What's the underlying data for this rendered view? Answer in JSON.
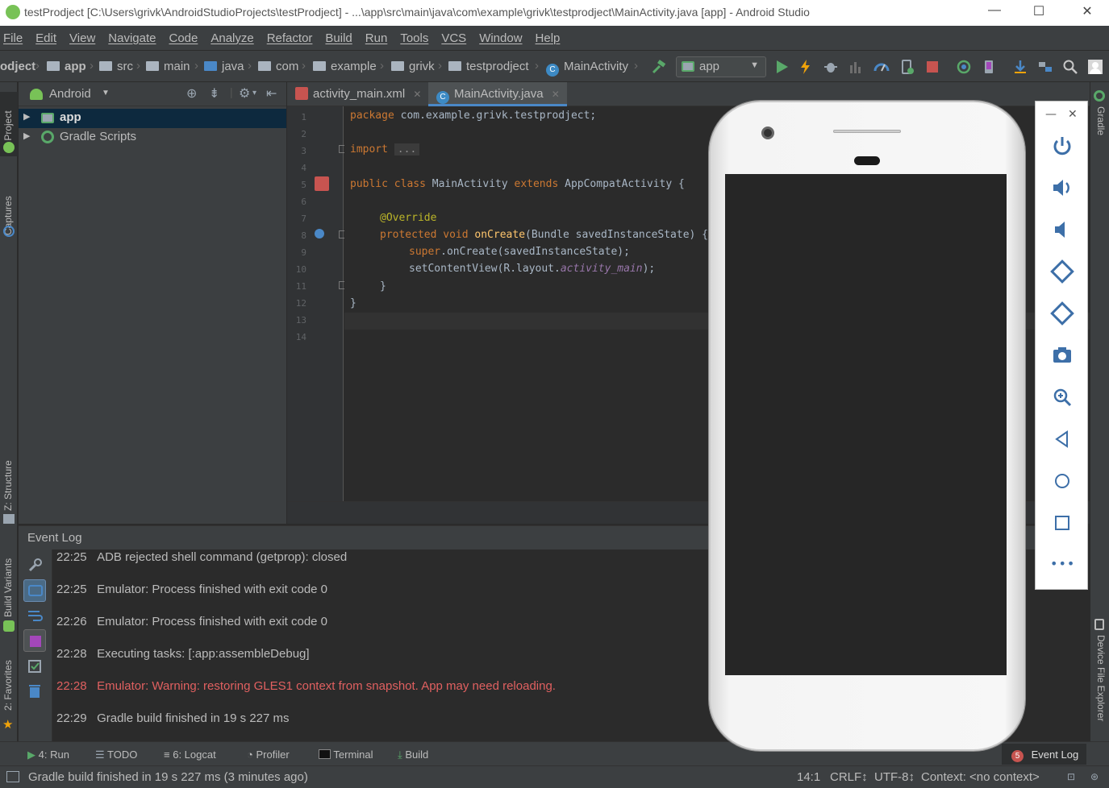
{
  "window": {
    "title": "testProdject [C:\\Users\\grivk\\AndroidStudioProjects\\testProdject] - ...\\app\\src\\main\\java\\com\\example\\grivk\\testprodject\\MainActivity.java [app] - Android Studio",
    "minimize": "—",
    "maximize": "☐",
    "close": "✕"
  },
  "menu": [
    "File",
    "Edit",
    "View",
    "Navigate",
    "Code",
    "Analyze",
    "Refactor",
    "Build",
    "Run",
    "Tools",
    "VCS",
    "Window",
    "Help"
  ],
  "breadcrumbs": [
    "odject",
    "app",
    "src",
    "main",
    "java",
    "com",
    "example",
    "grivk",
    "testprodject",
    "MainActivity"
  ],
  "run_config": "app",
  "left_tabs": {
    "project": "1: Project",
    "captures": "Captures",
    "structure": "Z: Structure",
    "build_variants": "Build Variants",
    "favorites": "2: Favorites"
  },
  "project_panel": {
    "view_mode": "Android",
    "tree": [
      {
        "label": "app",
        "selected": true
      },
      {
        "label": "Gradle Scripts",
        "selected": false
      }
    ]
  },
  "editor": {
    "tabs": [
      {
        "label": "activity_main.xml",
        "active": false
      },
      {
        "label": "MainActivity.java",
        "active": true
      }
    ],
    "line_numbers": [
      "1",
      "2",
      "3",
      "4",
      "5",
      "6",
      "7",
      "8",
      "9",
      "10",
      "11",
      "12",
      "13",
      "14"
    ],
    "code": {
      "l1_kw": "package",
      "l1_rest": " com.example.grivk.testprodject;",
      "l3_kw": "import",
      "l3_fold": "...",
      "l6_kw": "public class",
      "l6_name": " MainActivity ",
      "l6_kw2": "extends",
      "l6_rest": " AppCompatActivity {",
      "l8_ann": "@Override",
      "l9_kw": "protected void",
      "l9_fn": " onCreate",
      "l9_rest": "(Bundle savedInstanceState) {",
      "l10_kw": "super",
      "l10_rest": ".onCreate(savedInstanceState);",
      "l11_a": "setContentView(R.layout.",
      "l11_it": "activity_main",
      "l11_b": ");",
      "l12": "}",
      "l13": "}"
    }
  },
  "event_log": {
    "title": "Event Log",
    "entries": [
      {
        "time": "22:25",
        "text": "ADB rejected shell command (getprop): closed",
        "level": "info"
      },
      {
        "time": "22:25",
        "text": "Emulator: Process finished with exit code 0",
        "level": "info"
      },
      {
        "time": "22:26",
        "text": "Emulator: Process finished with exit code 0",
        "level": "info"
      },
      {
        "time": "22:28",
        "text": "Executing tasks: [:app:assembleDebug]",
        "level": "info"
      },
      {
        "time": "22:28",
        "text": "Emulator: Warning: restoring GLES1 context from snapshot. App may need reloading.",
        "level": "warn"
      },
      {
        "time": "22:29",
        "text": "Gradle build finished in 19 s 227 ms",
        "level": "info"
      }
    ]
  },
  "bottom_tabs": {
    "run": "4: Run",
    "todo": "TODO",
    "logcat": "6: Logcat",
    "profiler": "Profiler",
    "terminal": "Terminal",
    "build": "Build",
    "event_log": "Event Log",
    "event_log_badge": "5"
  },
  "right_tabs": {
    "gradle": "Gradle",
    "device_file_explorer": "Device File Explorer"
  },
  "status": {
    "message": "Gradle build finished in 19 s 227 ms (3 minutes ago)",
    "position": "14:1",
    "line_sep": "CRLF↕",
    "encoding": "UTF-8↕",
    "context": "Context: <no context>"
  },
  "emulator": {
    "minimize": "—",
    "close": "✕",
    "more": "•••"
  },
  "colors": {
    "accent_blue": "#4a88c7",
    "run_green": "#59a869",
    "stop_red": "#c75450",
    "warning_text": "#e06060"
  }
}
